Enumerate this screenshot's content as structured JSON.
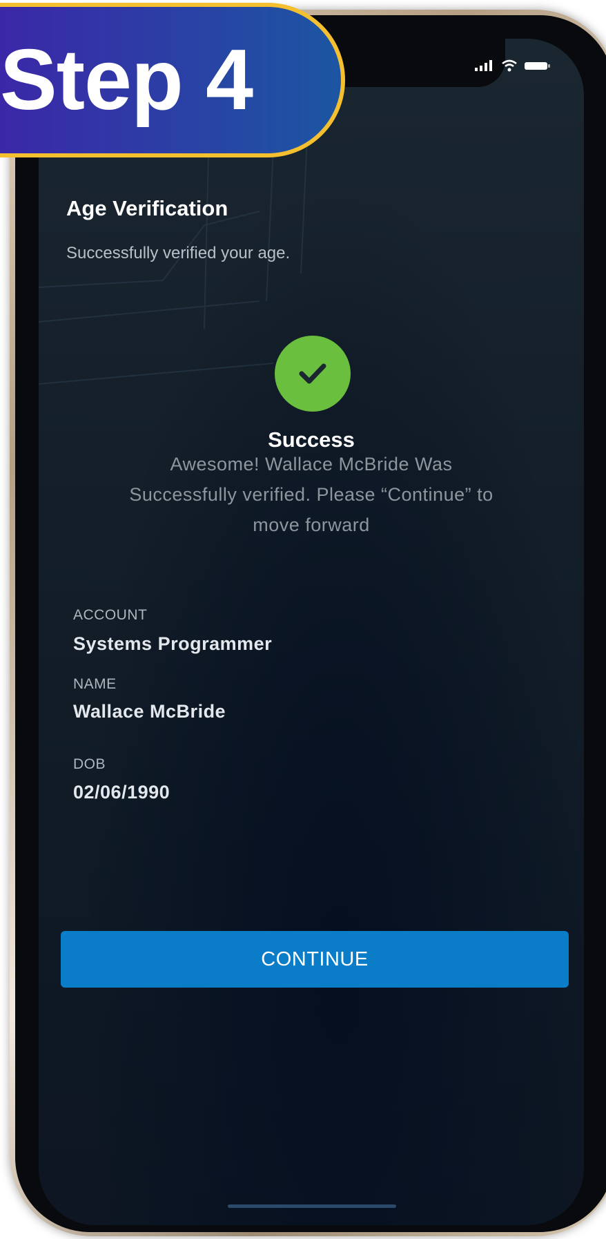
{
  "badge": {
    "label": "Step 4"
  },
  "status_bar": {
    "icons": [
      "signal-icon",
      "wifi-icon",
      "battery-icon"
    ]
  },
  "screen": {
    "title": "Age Verification",
    "subtitle": "Successfully verified your age.",
    "success_icon": "checkmark-icon",
    "success_title": "Success",
    "success_message": "Awesome! Wallace McBride Was Successfully verified. Please “Continue” to move forward"
  },
  "details": {
    "account_label": "ACCOUNT",
    "account_value": "Systems Programmer",
    "name_label": "NAME",
    "name_value": "Wallace McBride",
    "dob_label": "DOB",
    "dob_value": "02/06/1990"
  },
  "actions": {
    "continue_label": "CONTINUE"
  },
  "colors": {
    "accent_button": "#0a7cc8",
    "success_green": "#6bbf3e",
    "badge_border": "#f4c030",
    "badge_fill_start": "#3e22a8",
    "badge_fill_end": "#1c56a2",
    "screen_background": "#141f29"
  }
}
